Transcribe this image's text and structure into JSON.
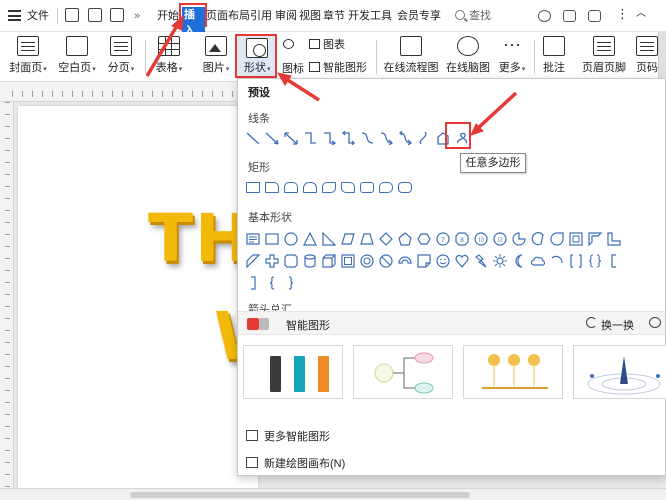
{
  "menubar": {
    "file_label": "文件",
    "expand_label": "»",
    "tabs": [
      "开始",
      "插入",
      "页面布局",
      "引用",
      "审阅",
      "视图",
      "章节",
      "开发工具",
      "会员专享"
    ],
    "search_label": "查找"
  },
  "ribbon": {
    "buttons": [
      {
        "label": "封面页",
        "caret": "▾"
      },
      {
        "label": "空白页",
        "caret": "▾"
      },
      {
        "label": "分页",
        "caret": "▾"
      },
      {
        "label": "表格",
        "caret": "▾"
      },
      {
        "label": "图片",
        "caret": "▾"
      },
      {
        "label": "形状",
        "caret": "▾"
      }
    ],
    "icon_label": "图标",
    "chart_label": "图表",
    "smart_art_label": "智能图形",
    "flowchart_label": "在线流程图",
    "mindmap_label": "在线脑图",
    "more_label": "更多",
    "comment_label": "批注",
    "header_footer_label": "页眉页脚",
    "page_label": "页码"
  },
  "document": {
    "line1": "TH",
    "line2": "W"
  },
  "shapes_panel": {
    "title": "预设",
    "sections": {
      "lines": "线条",
      "rectangles": "矩形",
      "basic": "基本形状",
      "arrows": "箭头总汇"
    },
    "tooltip": "任意多边形",
    "smart_graphics_label": "智能图形",
    "refresh_label": "换一换",
    "more_smart_label": "更多智能图形",
    "new_canvas_label": "新建绘图画布(N)"
  },
  "colors": {
    "accent_blue": "#1e6fd9",
    "highlight_red": "#e53935",
    "shape_stroke": "#3b6fb6",
    "text_gold": "#f2b90a"
  }
}
